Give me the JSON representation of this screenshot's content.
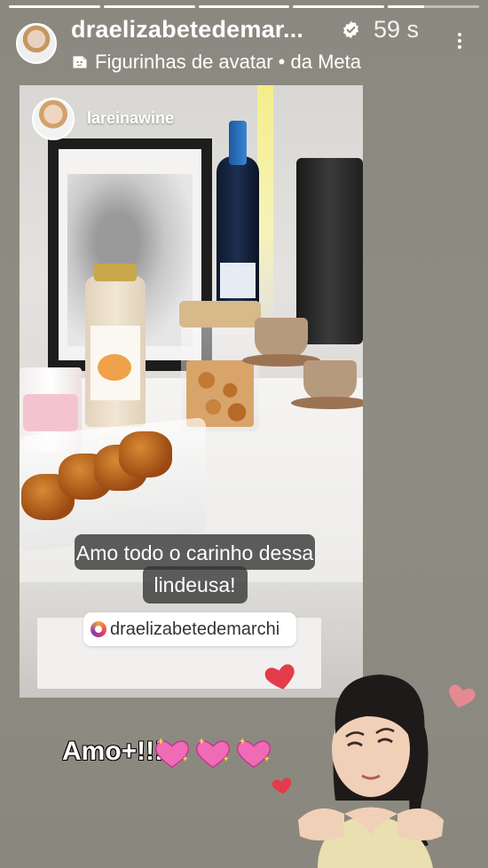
{
  "story": {
    "progress_segments": [
      1.0,
      1.0,
      1.0,
      1.0,
      0.4
    ],
    "colors": {
      "background": "#8c8a80",
      "accent_heart": "#e43b4a",
      "sparkle_heart": "#f06bb6"
    }
  },
  "header": {
    "username": "draelizabetedemar...",
    "verified_icon": "verified-badge-icon",
    "time": "59 s",
    "subtitle": "Figurinhas de avatar • da Meta",
    "more_icon": "more-vertical-icon"
  },
  "repost": {
    "username": "lareinawine",
    "caption_line1": "Amo todo o carinho dessa",
    "caption_line2": "lindeusa!",
    "mention": "draelizabetedemarchi"
  },
  "overlay": {
    "text": "Amo+!!!"
  }
}
